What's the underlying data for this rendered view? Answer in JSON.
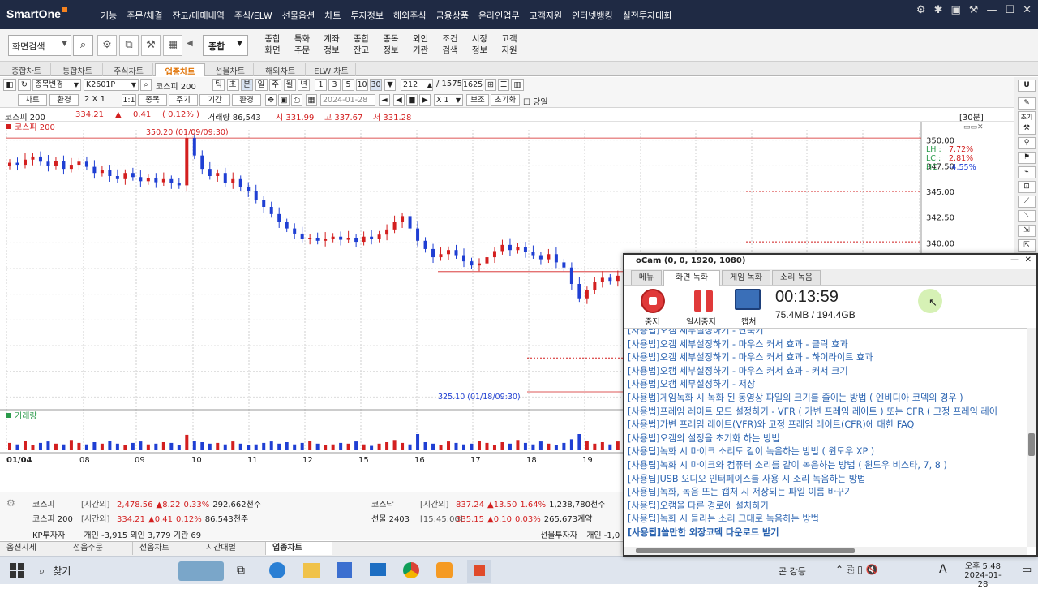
{
  "app": {
    "brand": "SmartOne"
  },
  "menubar": [
    "기능",
    "주문/체결",
    "잔고/매매내역",
    "주식/ELW",
    "선물옵션",
    "차트",
    "투자정보",
    "해외주식",
    "금융상품",
    "온라인업무",
    "고객지원",
    "인터넷뱅킹",
    "실전투자대회"
  ],
  "toolbar": {
    "search_value": "화면검색",
    "combo": "종합",
    "menus": [
      [
        "종합",
        "화면"
      ],
      [
        "특화",
        "주문"
      ],
      [
        "계좌",
        "정보"
      ],
      [
        "종합",
        "잔고"
      ],
      [
        "종목",
        "정보"
      ],
      [
        "외인",
        "기관"
      ],
      [
        "조건",
        "검색"
      ],
      [
        "시장",
        "정보"
      ],
      [
        "고객",
        "지원"
      ]
    ]
  },
  "chart_tabs": {
    "items": [
      "종합차트",
      "통합차트",
      "주식차트",
      "업종차트",
      "선물차트",
      "해외차트",
      "ELW 차트"
    ],
    "active": 3
  },
  "ctrl1": {
    "stock_change": "종목변경",
    "code": "K2601P",
    "name": "코스피 200",
    "periods": [
      "틱",
      "초",
      "분",
      "일",
      "주",
      "월",
      "년"
    ],
    "active_period": "분",
    "intervals": [
      "1",
      "3",
      "5",
      "10",
      "30"
    ],
    "interval_value": "30",
    "page_value": "212",
    "page_total": "/ 1575",
    "page_size": "1625"
  },
  "ctrl2": {
    "buttons": [
      "차트",
      "환경",
      "종목",
      "주기",
      "기간",
      "환경"
    ],
    "size": "2 X 1",
    "ratio": "1:1",
    "date": "2024-01-28",
    "multiplier": "X 1",
    "assist": "보조",
    "reset": "초기화",
    "today": "당일"
  },
  "infobar": {
    "name": "코스피 200",
    "price": "334.21",
    "arrow": "▲",
    "change": "0.41",
    "pct": "( 0.12% )",
    "volume": "거래량 86,543",
    "open": "시 331.99",
    "high": "고 337.67",
    "low": "저 331.28",
    "period_tag": "[30분]"
  },
  "chart_data": {
    "type": "candlestick",
    "title": "코스피 200",
    "volume_label": "거래량",
    "x_ticks": [
      "01/04",
      "08",
      "09",
      "10",
      "11",
      "12",
      "15",
      "16",
      "17",
      "18",
      "19"
    ],
    "y_ticks": [
      "350.00",
      "347.50",
      "345.00",
      "342.50",
      "340.00"
    ],
    "ylim": [
      324,
      351
    ],
    "high_annotation": "350.20 (01/09/09:30)",
    "low_annotation": "325.10 (01/18/09:30)",
    "ratios": {
      "LH": "7.72%",
      "LC": "2.81%",
      "HC": "-4.55%"
    },
    "closes": [
      347.8,
      347.6,
      348.1,
      348.4,
      347.9,
      347.5,
      348.0,
      347.2,
      347.6,
      347.9,
      347.4,
      346.8,
      347.1,
      346.5,
      346.2,
      346.8,
      346.4,
      346.0,
      346.3,
      345.9,
      346.2,
      345.8,
      345.6,
      350.2,
      348.5,
      347.2,
      346.5,
      346.8,
      345.8,
      346.2,
      345.4,
      345.0,
      344.2,
      343.5,
      342.8,
      342.0,
      341.4,
      340.9,
      340.4,
      340.5,
      340.2,
      340.4,
      340.6,
      340.3,
      340.5,
      340.1,
      340.6,
      340.4,
      340.8,
      341.3,
      342.0,
      342.6,
      341.4,
      340.2,
      339.4,
      338.6,
      338.9,
      339.3,
      338.8,
      338.2,
      337.8,
      338.0,
      338.6,
      339.2,
      339.8,
      339.3,
      339.6,
      339.1,
      338.8,
      338.4,
      338.9,
      338.1,
      337.6,
      336.0,
      334.6,
      335.4,
      336.2,
      336.6,
      336.3,
      336.8,
      336.2,
      335.8,
      336.0,
      335.4,
      334.8,
      333.0,
      331.2,
      330.0,
      329.0,
      328.2,
      327.8,
      327.5,
      326.9,
      327.3,
      327.1,
      326.8,
      327.2,
      326.5,
      327.5,
      327.9,
      328.4,
      328.0,
      327.6,
      328.2,
      327.4,
      326.8,
      327.2,
      327.6,
      331.5,
      331.9,
      331.4,
      331.6,
      331.2,
      331.5,
      331.3,
      331.7,
      331.6,
      331.4
    ],
    "volumes": [
      10,
      8,
      13,
      7,
      10,
      12,
      9,
      8,
      14,
      10,
      8,
      11,
      9,
      13,
      9,
      7,
      10,
      12,
      8,
      9,
      11,
      10,
      7,
      21,
      13,
      11,
      9,
      10,
      8,
      12,
      9,
      7,
      8,
      10,
      12,
      9,
      11,
      8,
      10,
      13,
      9,
      7,
      8,
      10,
      9,
      12,
      8,
      6,
      9,
      11,
      14,
      10,
      8,
      22,
      11,
      9,
      7,
      12,
      10,
      8,
      9,
      13,
      10,
      7,
      11,
      9,
      14,
      10,
      8,
      12,
      9,
      7,
      10,
      15,
      22,
      13,
      9,
      11,
      8,
      12,
      10,
      7,
      9,
      13,
      10,
      11,
      21,
      12,
      9,
      8,
      10,
      11,
      9,
      7,
      10,
      12,
      8,
      13,
      9,
      8,
      10,
      11,
      9,
      12,
      8,
      7,
      10,
      9,
      16,
      11,
      12,
      10,
      9,
      11,
      8,
      10,
      9,
      11
    ]
  },
  "bottom": {
    "rows": [
      {
        "market": "코스피",
        "tag": "[시간외]",
        "price": "2,478.56",
        "chg": "▲8.22",
        "pct": "0.33%",
        "vol": "292,662천주"
      },
      {
        "market": "코스피 200",
        "tag": "[시간외]",
        "price": "334.21",
        "chg": "▲0.41",
        "pct": "0.12%",
        "vol": "86,543천주"
      }
    ],
    "right_rows": [
      {
        "market": "코스닥",
        "tag": "[시간외]",
        "price": "837.24",
        "chg": "▲13.50",
        "pct": "1.64%",
        "vol": "1,238,780천주"
      },
      {
        "market": "선물 2403",
        "tag": "[15:45:00]",
        "price": "335.15",
        "chg": "▲0.10",
        "pct": "0.03%",
        "vol": "265,673계약"
      }
    ],
    "investors_label": "KP투자자",
    "investors": "개인 -3,915  외인 3,779  기관 69",
    "futures_label": "선물투자자",
    "futures": "개인 -1,0"
  },
  "bottom_tabs": {
    "items": [
      "옵션시세",
      "선옵주문",
      "선옵차트",
      "시간대별",
      "업종차트"
    ],
    "active": 4
  },
  "ocam": {
    "title": "oCam (0, 0, 1920, 1080)",
    "tabs": [
      "메뉴",
      "화면 녹화",
      "게임 녹화",
      "소리 녹음"
    ],
    "active_tab": 1,
    "stop_label": "중지",
    "pause_label": "일시중지",
    "capture_label": "캡처",
    "timer": "00:13:59",
    "size": "75.4MB / 194.4GB",
    "items": [
      "[사용법]오캠 세부설정하기 - 단축키",
      "[사용법]오캠 세부설정하기 - 마우스 커서 효과 - 클릭 효과",
      "[사용법]오캠 세부설정하기 - 마우스 커서 효과 - 하이라이트 효과",
      "[사용법]오캠 세부설정하기 - 마우스 커서 효과 - 커서 크기",
      "[사용법]오캠 세부설정하기 - 저장",
      "[사용법]게임녹화 시 녹화 된 동영상 파일의 크기를 줄이는 방법 ( 엔비디아 코덱의 경우 )",
      "[사용법]프레임 레이트 모드 설정하기 - VFR ( 가변 프레임 레이트 ) 또는 CFR ( 고정 프레임 레이",
      "[사용법]가변 프레임 레이트(VFR)와 고정 프레임 레이트(CFR)에 대한 FAQ",
      "[사용법]오캠의 설정을 초기화 하는 방법",
      "[사용팁]녹화 시 마이크 소리도 같이 녹음하는 방법 ( 윈도우 XP )",
      "[사용팁]녹화 시 마이크와 컴퓨터 소리를 같이 녹음하는 방법 ( 윈도우 비스타, 7, 8 )",
      "[사용팁]USB 오디오 인터페이스를 사용 시 소리 녹음하는 방법",
      "[사용팁]녹화, 녹음 또는 캡처 시 저장되는 파일 이름 바꾸기",
      "[사용팁]오캠을 다른 경로에 설치하기",
      "[사용팁]녹화 시 들리는 소리 그대로 녹음하는 방법",
      "[사용팁]쓸만한 외장코덱 다운로드 받기"
    ]
  },
  "taskbar": {
    "search_label": "찾기",
    "tray_text": "곤 강등",
    "ime": "A",
    "time": "오후 5:48",
    "date": "2024-01-28"
  },
  "colors": {
    "up": "#d31f1f",
    "down": "#1f3fd3",
    "titlebar": "#1f2a44",
    "accent": "#e07000"
  }
}
